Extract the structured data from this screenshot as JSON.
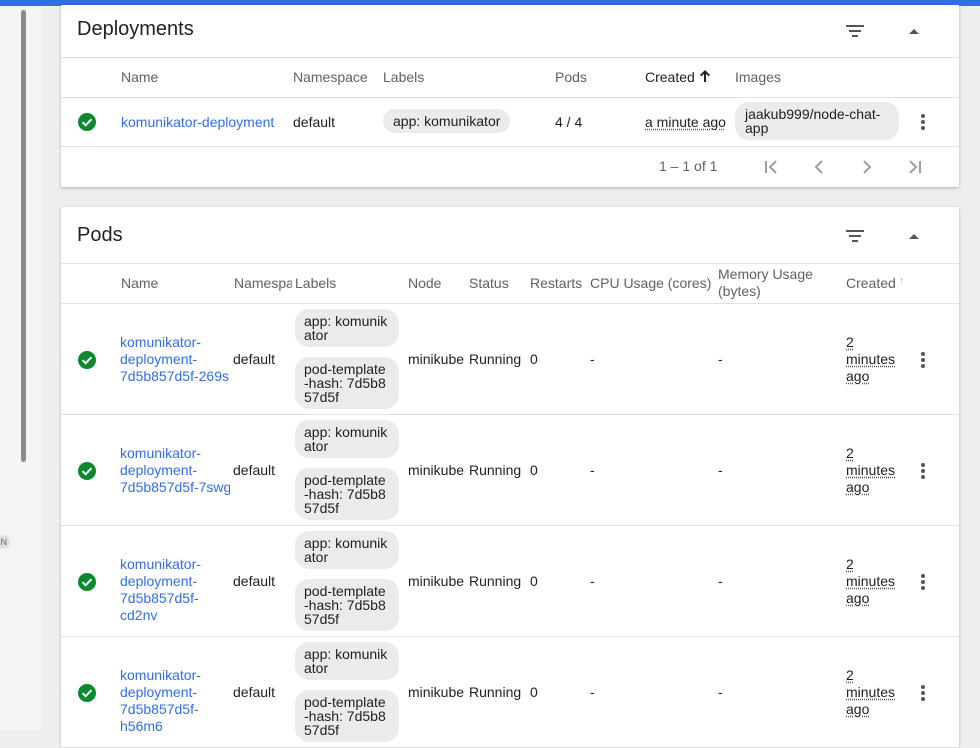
{
  "colors": {
    "accent": "#326de6",
    "success": "#0b8a2d",
    "chip_bg": "#ebebeb"
  },
  "deployments": {
    "title": "Deployments",
    "filter_icon": "filter-list-icon",
    "collapse_icon": "arrow-drop-up-icon",
    "columns": {
      "name": "Name",
      "namespace": "Namespace",
      "labels": "Labels",
      "pods": "Pods",
      "created": "Created",
      "images": "Images"
    },
    "sort_icon": "arrow-upward-icon",
    "rows": [
      {
        "status_icon": "check-circle-icon",
        "name": "komunikator-deployment",
        "namespace": "default",
        "label": "app: komunikator",
        "pods": "4 / 4",
        "created": "a minute ago",
        "image_line1": "jaakub999/node-chat-",
        "image_line2": "app"
      }
    ],
    "pagination": {
      "range": "1 – 1 of 1"
    }
  },
  "pods": {
    "title": "Pods",
    "filter_icon": "filter-list-icon",
    "collapse_icon": "arrow-drop-up-icon",
    "columns": {
      "name": "Name",
      "namespace": "Namespa",
      "labels": "Labels",
      "node": "Node",
      "status": "Status",
      "restarts": "Restarts",
      "cpu": "CPU Usage (cores)",
      "memory_line1": "Memory Usage",
      "memory_line2": "(bytes)",
      "created": "Created",
      "created_sort": "↑"
    },
    "rows": [
      {
        "name1": "komunikator-",
        "name2": "deployment-",
        "name3": "7d5b857d5f-269s",
        "name4": "",
        "namespace": "default",
        "label1_a": "app: komunik",
        "label1_b": "ator",
        "label2_a": "pod-template",
        "label2_b": "-hash: 7d5b8",
        "label2_c": "57d5f",
        "node": "minikube",
        "status": "Running",
        "restarts": "0",
        "cpu": "-",
        "memory": "-",
        "created1": "2",
        "created2": "minutes",
        "created3": "ago"
      },
      {
        "name1": "komunikator-",
        "name2": "deployment-",
        "name3": "7d5b857d5f-7swg",
        "name4": "",
        "namespace": "default",
        "label1_a": "app: komunik",
        "label1_b": "ator",
        "label2_a": "pod-template",
        "label2_b": "-hash: 7d5b8",
        "label2_c": "57d5f",
        "node": "minikube",
        "status": "Running",
        "restarts": "0",
        "cpu": "-",
        "memory": "-",
        "created1": "2",
        "created2": "minutes",
        "created3": "ago"
      },
      {
        "name1": "komunikator-",
        "name2": "deployment-",
        "name3": "7d5b857d5f-",
        "name4": "cd2nv",
        "namespace": "default",
        "label1_a": "app: komunik",
        "label1_b": "ator",
        "label2_a": "pod-template",
        "label2_b": "-hash: 7d5b8",
        "label2_c": "57d5f",
        "node": "minikube",
        "status": "Running",
        "restarts": "0",
        "cpu": "-",
        "memory": "-",
        "created1": "2",
        "created2": "minutes",
        "created3": "ago"
      },
      {
        "name1": "komunikator-",
        "name2": "deployment-",
        "name3": "7d5b857d5f-",
        "name4": "h56m6",
        "namespace": "default",
        "label1_a": "app: komunik",
        "label1_b": "ator",
        "label2_a": "pod-template",
        "label2_b": "-hash: 7d5b8",
        "label2_c": "57d5f",
        "node": "minikube",
        "status": "Running",
        "restarts": "0",
        "cpu": "-",
        "memory": "-",
        "created1": "2",
        "created2": "minutes",
        "created3": "ago"
      }
    ]
  },
  "side": {
    "badge": "N"
  }
}
